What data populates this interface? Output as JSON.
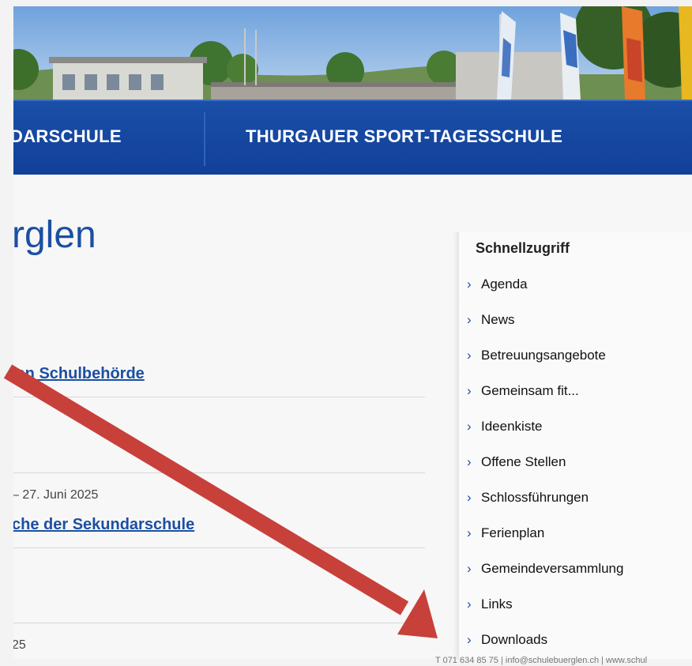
{
  "nav": {
    "items": [
      "DARSCHULE",
      "THURGAUER SPORT-TAGESSCHULE"
    ]
  },
  "page_title": "rglen",
  "news": [
    {
      "link": "len Schulbehörde"
    },
    {
      "date": "– 27. Juni 2025",
      "link": "che der Sekundarschule"
    },
    {
      "date": "25"
    }
  ],
  "quick_access": {
    "title": "Schnellzugriff",
    "items": [
      "Agenda",
      "News",
      "Betreuungsangebote",
      "Gemeinsam fit...",
      "Ideenkiste",
      "Offene Stellen",
      "Schlossführungen",
      "Ferienplan",
      "Gemeindeversammlung",
      "Links",
      "Downloads"
    ]
  },
  "footer": {
    "contact": "T 071 634 85 75 | info@schulebuerglen.ch | www.schul"
  },
  "colors": {
    "nav_blue": "#1a4fa8",
    "link_blue": "#1b4fa2",
    "arrow_red": "#c8403a"
  },
  "icons": [
    "chevron-right-icon",
    "annotation-arrow"
  ]
}
